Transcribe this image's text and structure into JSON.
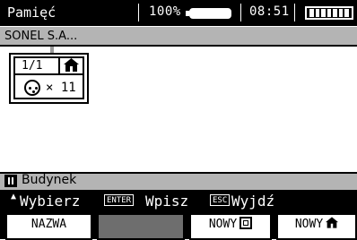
{
  "status": {
    "title": "Pamięć",
    "battery_percent": "100%",
    "time": "08:51",
    "icons": {
      "battery": "battery-icon",
      "signal": "signal-icon"
    }
  },
  "subheader": {
    "client": "SONEL S.A..."
  },
  "card": {
    "index": "1/1",
    "count": "× 11",
    "icons": [
      "home-icon",
      "socket-icon"
    ]
  },
  "object_bar": {
    "name": "Budynek",
    "icon": "object-icon"
  },
  "hints": {
    "select": "Wybierz",
    "enter_key": "ENTER",
    "enter": "Wpisz",
    "esc_key": "ESC",
    "exit": "Wyjdź"
  },
  "softkeys": {
    "name": "NAZWA",
    "new_point": "NOWY",
    "new_object": "NOWY"
  },
  "colors": {
    "gray": "#b4b4b4",
    "dark_gray": "#6e6e6e"
  }
}
